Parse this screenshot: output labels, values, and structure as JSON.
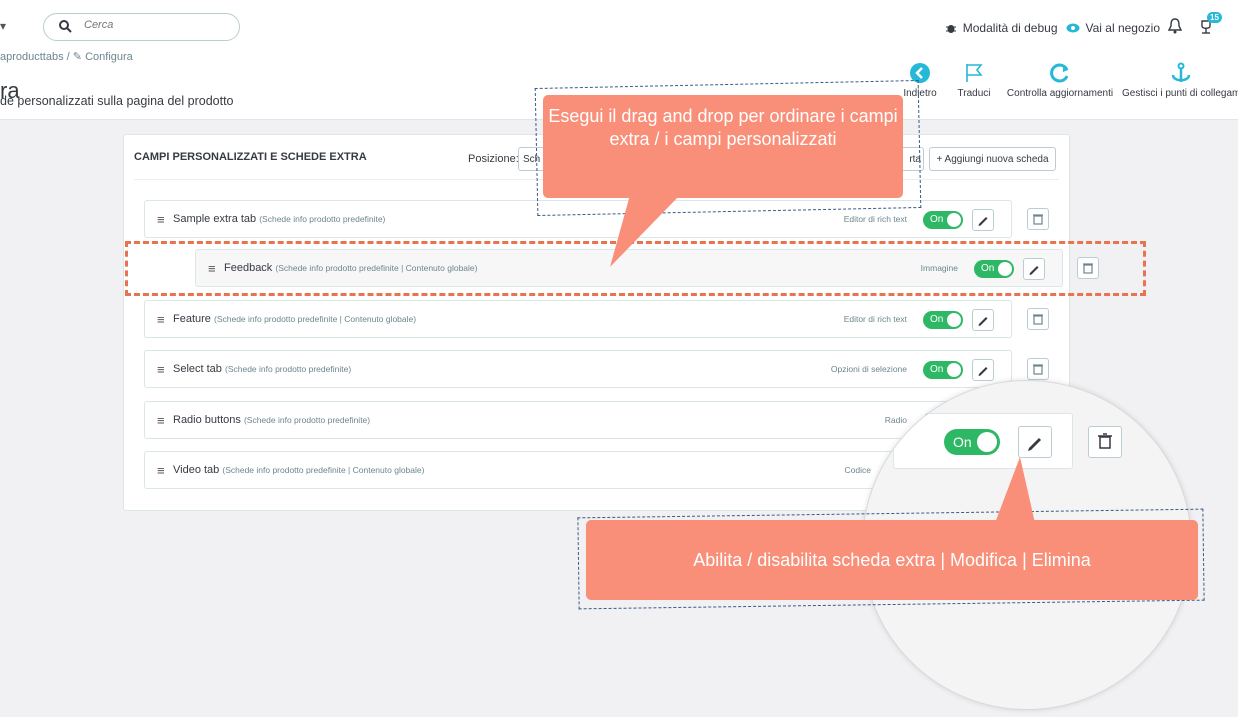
{
  "header": {
    "search_placeholder": "Cerca",
    "debug_label": "Modalità di debug",
    "shop_label": "Vai al negozio",
    "notification_count": "15"
  },
  "breadcrumb": {
    "module": "aproducttabs",
    "separator": "/",
    "current": "Configura"
  },
  "page": {
    "title": "ra",
    "subtitle": "de personalizzati sulla pagina del prodotto"
  },
  "toolbar": {
    "back": "Indietro",
    "translate": "Traduci",
    "check_updates": "Controlla aggiornamenti",
    "hooks": "Gestisci i punti di collegam"
  },
  "panel": {
    "heading": "CAMPI PERSONALIZZATI E SCHEDE EXTRA",
    "position_label": "Posizione:",
    "position_value": "Sch",
    "partial_button": "rta",
    "add_button": "+ Aggiungi nuova scheda"
  },
  "rows": [
    {
      "name": "Sample extra tab",
      "meta": "(Schede info prodotto predefinite)",
      "type": "Editor di rich text",
      "toggle": "On"
    },
    {
      "name": "Feedback",
      "meta": "(Schede info prodotto predefinite | Contenuto globale)",
      "type": "Immagine",
      "toggle": "On"
    },
    {
      "name": "Feature",
      "meta": "(Schede info prodotto predefinite | Contenuto globale)",
      "type": "Editor di rich text",
      "toggle": "On"
    },
    {
      "name": "Select tab",
      "meta": "(Schede info prodotto predefinite)",
      "type": "Opzioni di selezione",
      "toggle": "On"
    },
    {
      "name": "Radio buttons",
      "meta": "(Schede info prodotto predefinite)",
      "type": "Radio",
      "toggle": "On"
    },
    {
      "name": "Video tab",
      "meta": "(Schede info prodotto predefinite | Contenuto globale)",
      "type": "Codice",
      "toggle": ""
    }
  ],
  "callouts": {
    "drag_drop": "Esegui il drag and drop per ordinare i campi extra / i campi personalizzati",
    "actions": "Abilita / disabilita scheda extra | Modifica | Elimina"
  },
  "zoom": {
    "toggle": "On"
  },
  "colors": {
    "toggle_green": "#2eb865",
    "accent_blue": "#25b9d7",
    "callout_salmon": "#f98f78",
    "highlight_dash": "#e7734f"
  }
}
